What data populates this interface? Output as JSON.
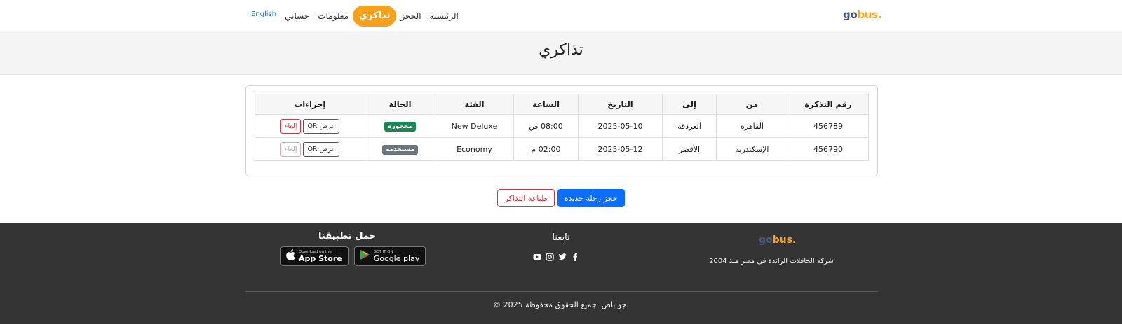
{
  "header": {
    "logo": {
      "go": "go",
      "bus": "bus."
    },
    "nav": {
      "lang": "English",
      "account": "حسابي",
      "info": "معلومات",
      "tickets": "تذاكري",
      "booking": "الحجز",
      "home": "الرئيسية"
    },
    "accent_color": "#f5a11c"
  },
  "page": {
    "title": "تذاكري"
  },
  "table": {
    "headers": {
      "ticket_no": "رقم التذكرة",
      "from": "من",
      "to": "إلى",
      "date": "التاريخ",
      "time": "الساعة",
      "class": "الفئة",
      "status": "الحالة",
      "actions": "إجراءات"
    },
    "rows": [
      {
        "ticket_no": "456789",
        "from": "القاهرة",
        "to": "الغردقة",
        "date": "2025-05-10",
        "time": "08:00 ص",
        "class": "New Deluxe",
        "status": "محجوزة",
        "status_color": "#198754",
        "qr_label": "عرض QR",
        "cancel_label": "إلغاء",
        "cancel_enabled": true
      },
      {
        "ticket_no": "456790",
        "from": "الإسكندرية",
        "to": "الأقصر",
        "date": "2025-05-12",
        "time": "02:00 م",
        "class": "Economy",
        "status": "مستخدمة",
        "status_color": "#6c757d",
        "qr_label": "عرض QR",
        "cancel_label": "إلغاء",
        "cancel_enabled": false
      }
    ]
  },
  "actions": {
    "print": "طباعة التذاكر",
    "new_booking": "حجز رحلة جديدة"
  },
  "footer": {
    "logo": {
      "go": "go",
      "bus": "bus."
    },
    "tagline": "شركة الحافلات الرائدة في مصر منذ 2004",
    "follow_title": "تابعنا",
    "social_icons": [
      "facebook-icon",
      "twitter-icon",
      "instagram-icon",
      "youtube-icon"
    ],
    "app_title": "حمل تطبيقنا",
    "app_store": {
      "small": "Download on the",
      "big": "App Store"
    },
    "google_play": {
      "small": "GET IT ON",
      "big": "Google play"
    },
    "copyright": "© 2025 جو باص. جميع الحقوق محفوظة."
  }
}
